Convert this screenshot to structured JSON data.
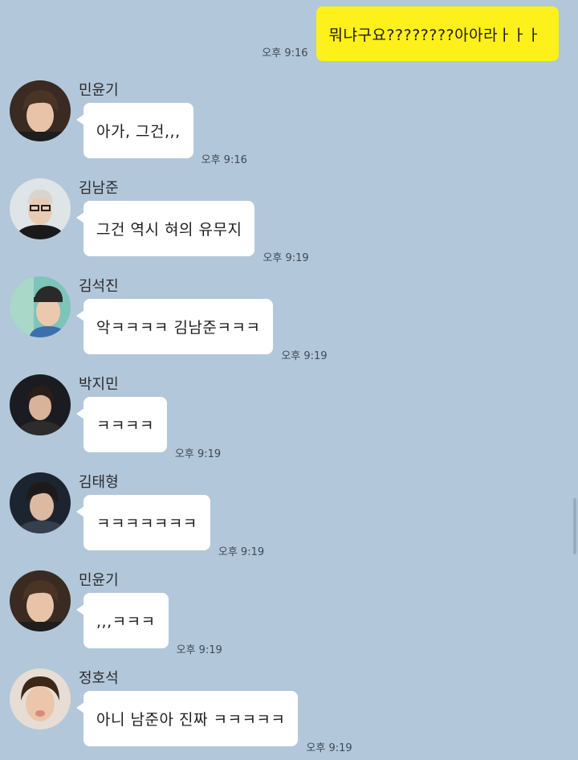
{
  "colors": {
    "background": "#b2c7da",
    "outgoing_bubble": "#fef01b",
    "incoming_bubble": "#ffffff",
    "timestamp": "#3f4a55"
  },
  "outgoing": {
    "text": "뭐냐구요????????아아라ㅏㅏㅏ",
    "time": "오후 9:16"
  },
  "messages": [
    {
      "sender": "민윤기",
      "text": "아가, 그건,,,",
      "time": "오후 9:16",
      "avatar": "avatar-photo-icon"
    },
    {
      "sender": "김남준",
      "text": "그건 역시 혀의 유무지",
      "time": "오후 9:19",
      "avatar": "avatar-photo-icon"
    },
    {
      "sender": "김석진",
      "text": "악ㅋㅋㅋㅋ 김남준ㅋㅋㅋ",
      "time": "오후 9:19",
      "avatar": "avatar-photo-icon"
    },
    {
      "sender": "박지민",
      "text": "ㅋㅋㅋㅋ",
      "time": "오후 9:19",
      "avatar": "avatar-photo-icon"
    },
    {
      "sender": "김태형",
      "text": "ㅋㅋㅋㅋㅋㅋㅋ",
      "time": "오후 9:19",
      "avatar": "avatar-photo-icon"
    },
    {
      "sender": "민윤기",
      "text": ",,,ㅋㅋㅋ",
      "time": "오후 9:19",
      "avatar": "avatar-photo-icon"
    },
    {
      "sender": "정호석",
      "text": "아니 남준아 진짜 ㅋㅋㅋㅋㅋ",
      "time": "오후 9:19",
      "avatar": "avatar-photo-icon"
    }
  ]
}
